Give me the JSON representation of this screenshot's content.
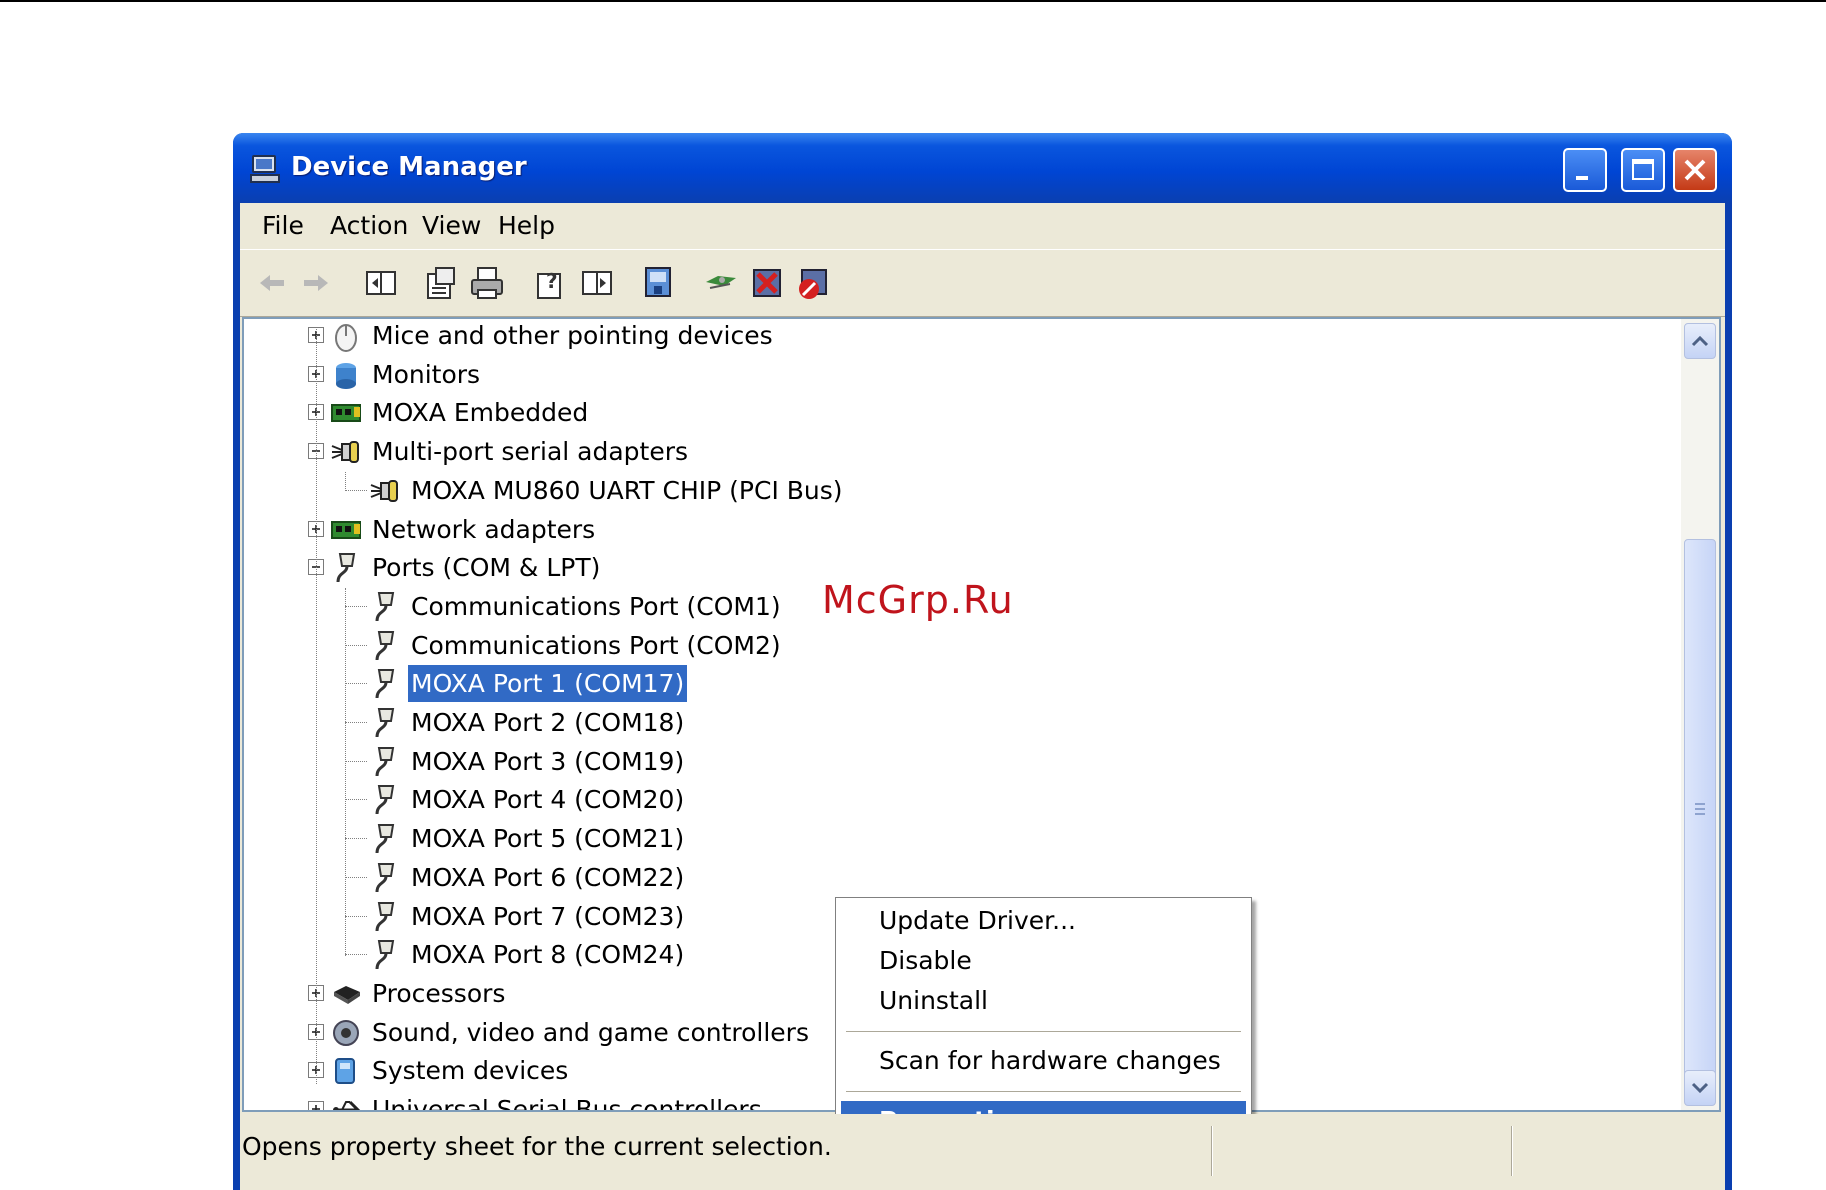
{
  "window": {
    "title": "Device Manager"
  },
  "menu": {
    "items": [
      "File",
      "Action",
      "View",
      "Help"
    ]
  },
  "toolbar": {
    "buttons": [
      {
        "name": "back-arrow-icon"
      },
      {
        "name": "forward-arrow-icon"
      },
      {
        "name": "show-hide-tree-icon"
      },
      {
        "name": "properties-icon"
      },
      {
        "name": "print-icon"
      },
      {
        "name": "help-icon"
      },
      {
        "name": "show-hide-action-pane-icon"
      },
      {
        "name": "update-driver-icon"
      },
      {
        "name": "scan-hardware-icon"
      },
      {
        "name": "uninstall-icon"
      },
      {
        "name": "disable-icon"
      }
    ]
  },
  "tree": {
    "rows": [
      {
        "label": "Mice and other pointing devices",
        "icon": "mouse-icon",
        "expander": "+"
      },
      {
        "label": "Monitors",
        "icon": "monitor-icon",
        "expander": "+"
      },
      {
        "label": "MOXA Embedded",
        "icon": "network-card-icon",
        "expander": "+"
      },
      {
        "label": "Multi-port serial adapters",
        "icon": "serial-adapter-icon",
        "expander": "-"
      },
      {
        "label": "MOXA MU860 UART CHIP (PCI Bus)",
        "icon": "serial-adapter-icon",
        "expander": ""
      },
      {
        "label": "Network adapters",
        "icon": "network-card-icon",
        "expander": "+"
      },
      {
        "label": "Ports (COM & LPT)",
        "icon": "port-icon",
        "expander": "-"
      },
      {
        "label": "Communications Port (COM1)",
        "icon": "port-icon",
        "expander": ""
      },
      {
        "label": "Communications Port (COM2)",
        "icon": "port-icon",
        "expander": ""
      },
      {
        "label": "MOXA Port 1 (COM17)",
        "icon": "port-icon",
        "expander": "",
        "selected": true
      },
      {
        "label": "MOXA Port 2 (COM18)",
        "icon": "port-icon",
        "expander": ""
      },
      {
        "label": "MOXA Port 3 (COM19)",
        "icon": "port-icon",
        "expander": ""
      },
      {
        "label": "MOXA Port 4 (COM20)",
        "icon": "port-icon",
        "expander": ""
      },
      {
        "label": "MOXA Port 5 (COM21)",
        "icon": "port-icon",
        "expander": ""
      },
      {
        "label": "MOXA Port 6 (COM22)",
        "icon": "port-icon",
        "expander": ""
      },
      {
        "label": "MOXA Port 7 (COM23)",
        "icon": "port-icon",
        "expander": ""
      },
      {
        "label": "MOXA Port 8 (COM24)",
        "icon": "port-icon",
        "expander": ""
      },
      {
        "label": "Processors",
        "icon": "processor-icon",
        "expander": "+"
      },
      {
        "label": "Sound, video and game controllers",
        "icon": "sound-icon",
        "expander": "+"
      },
      {
        "label": "System devices",
        "icon": "system-device-icon",
        "expander": "+"
      },
      {
        "label": "Universal Serial Bus controllers",
        "icon": "usb-icon",
        "expander": "+"
      }
    ]
  },
  "context_menu": {
    "items": [
      "Update Driver...",
      "Disable",
      "Uninstall",
      "Scan for hardware changes",
      "Properties"
    ],
    "active": "Properties"
  },
  "status": {
    "text": "Opens property sheet for the current selection."
  },
  "watermark": "McGrp.Ru",
  "colors": {
    "title_bar": "#0045d4",
    "selection": "#316ac5",
    "watermark": "#c0141c",
    "close_button": "#c43a16"
  }
}
